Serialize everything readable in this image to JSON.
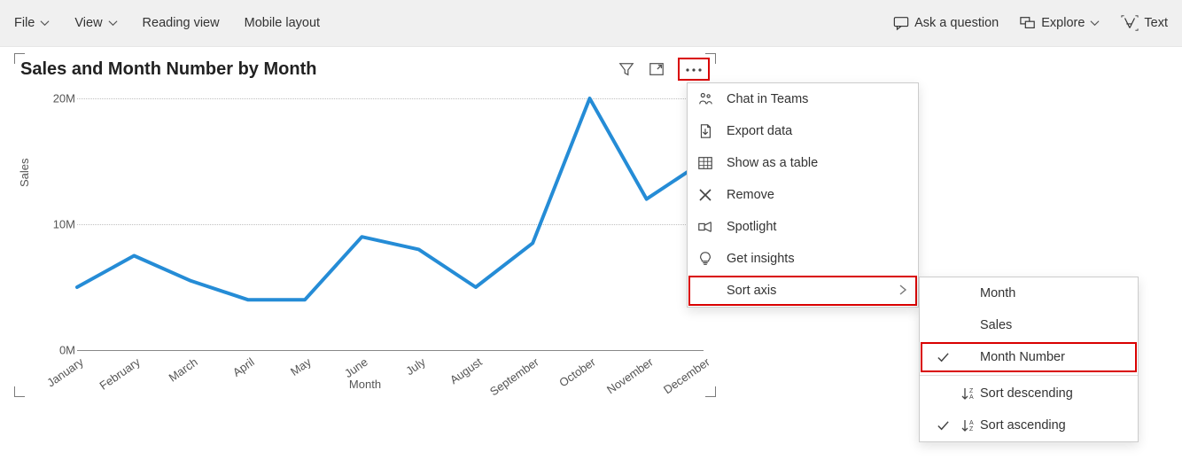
{
  "toolbar": {
    "left": {
      "file": "File",
      "view": "View",
      "reading_view": "Reading view",
      "mobile_layout": "Mobile layout"
    },
    "right": {
      "ask": "Ask a question",
      "explore": "Explore",
      "text": "Text"
    }
  },
  "chart": {
    "title": "Sales and Month Number by Month",
    "y_title": "Sales",
    "x_title": "Month",
    "y_ticks": [
      "0M",
      "10M",
      "20M"
    ]
  },
  "context_menu": {
    "items": {
      "chat": "Chat in Teams",
      "export": "Export data",
      "table": "Show as a table",
      "remove": "Remove",
      "spotlight": "Spotlight",
      "insights": "Get insights",
      "sort_axis": "Sort axis"
    }
  },
  "sort_submenu": {
    "month": "Month",
    "sales": "Sales",
    "month_number": "Month Number",
    "desc": "Sort descending",
    "asc": "Sort ascending"
  },
  "chart_data": {
    "type": "line",
    "title": "Sales and Month Number by Month",
    "xlabel": "Month",
    "ylabel": "Sales",
    "ylim": [
      0,
      20000000
    ],
    "y_tick_values": [
      0,
      10000000,
      20000000
    ],
    "categories": [
      "January",
      "February",
      "March",
      "April",
      "May",
      "June",
      "July",
      "August",
      "September",
      "October",
      "November",
      "December"
    ],
    "series": [
      {
        "name": "Sales",
        "values": [
          5000000,
          7500000,
          5500000,
          4000000,
          4000000,
          9000000,
          8000000,
          5000000,
          8500000,
          20000000,
          12000000,
          15000000
        ]
      }
    ]
  }
}
